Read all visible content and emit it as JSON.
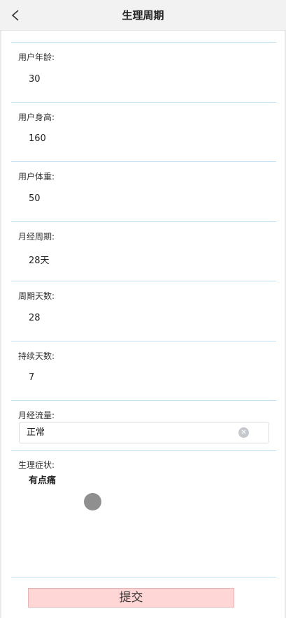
{
  "header": {
    "title": "生理周期",
    "back_icon": "chevron-left-icon"
  },
  "fields": [
    {
      "label": "用户年龄:",
      "value": "30"
    },
    {
      "label": "用户身高:",
      "value": "160"
    },
    {
      "label": "用户体重:",
      "value": "50"
    },
    {
      "label": "月经周期:",
      "value": "28天"
    },
    {
      "label": "周期天数:",
      "value": "28"
    },
    {
      "label": "持续天数:",
      "value": "7"
    }
  ],
  "flow": {
    "label": "月经流量:",
    "value": "正常",
    "clear_icon": "clear-icon"
  },
  "symptoms": {
    "label": "生理症状:",
    "value": "有点痛"
  },
  "submit": {
    "label": "提交"
  },
  "colors": {
    "header_bg": "#f2f2f2",
    "divider": "#bfe1f3",
    "submit_bg": "#ffd6d6"
  }
}
